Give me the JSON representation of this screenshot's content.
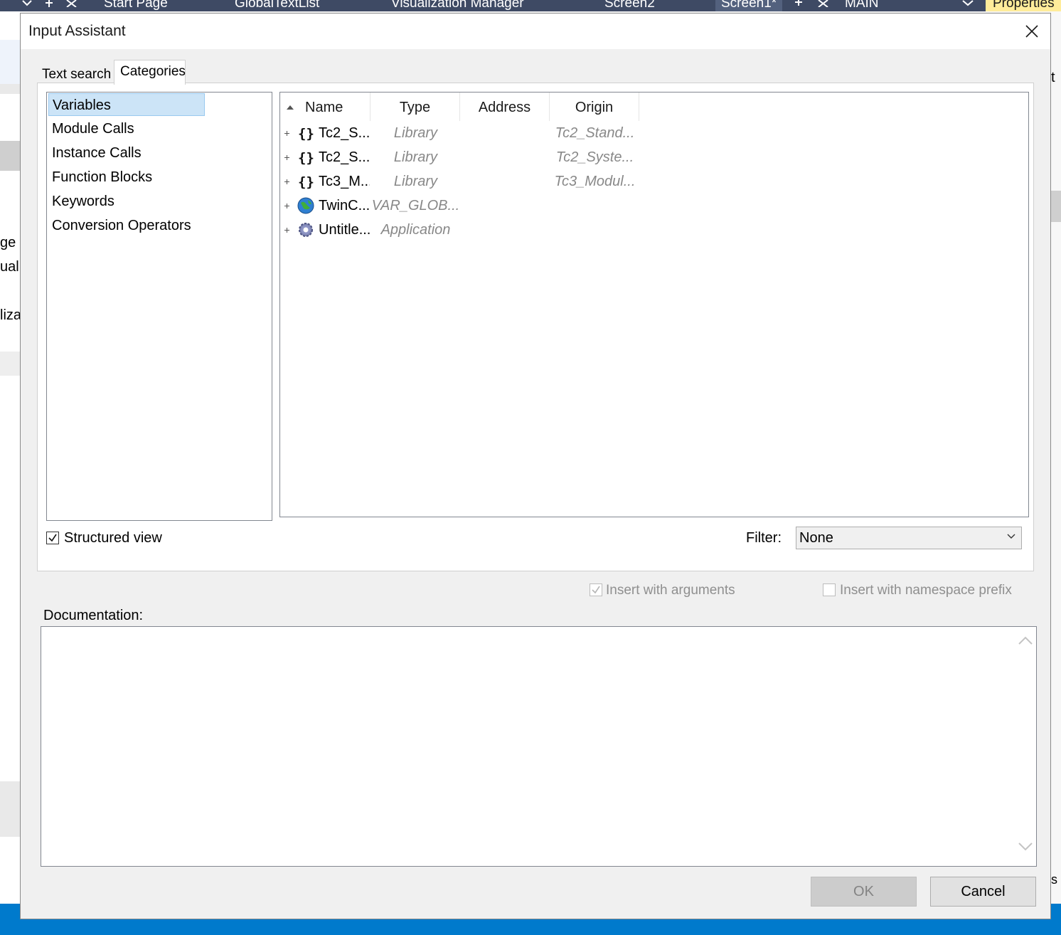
{
  "ide": {
    "tabs": [
      "Start Page",
      "GlobalTextList",
      "Visualization Manager",
      "Screen2",
      "Screen1*",
      "MAIN"
    ],
    "properties_label": "Properties",
    "left_fragments": [
      "ge",
      "uali",
      "liza"
    ],
    "right_fragments": [
      "t",
      "s"
    ]
  },
  "dialog": {
    "title": "Input Assistant",
    "tabs": {
      "text_search": "Text search",
      "categories": "Categories"
    },
    "categories": [
      "Variables",
      "Module Calls",
      "Instance Calls",
      "Function Blocks",
      "Keywords",
      "Conversion Operators"
    ],
    "selected_category": "Variables",
    "columns": {
      "name": "Name",
      "type": "Type",
      "address": "Address",
      "origin": "Origin"
    },
    "rows": [
      {
        "name": "Tc2_S...",
        "type": "Library",
        "address": "",
        "origin": "Tc2_Stand...",
        "icon": "namespace-icon"
      },
      {
        "name": "Tc2_S...",
        "type": "Library",
        "address": "",
        "origin": "Tc2_Syste...",
        "icon": "namespace-icon"
      },
      {
        "name": "Tc3_M...",
        "type": "Library",
        "address": "",
        "origin": "Tc3_Modul...",
        "icon": "namespace-icon"
      },
      {
        "name": "TwinC...",
        "type": "VAR_GLOB...",
        "address": "",
        "origin": "",
        "icon": "globe-icon"
      },
      {
        "name": "Untitle...",
        "type": "Application",
        "address": "",
        "origin": "",
        "icon": "gear-icon"
      }
    ],
    "structured_view": {
      "label": "Structured view",
      "checked": true
    },
    "filter": {
      "label": "Filter:",
      "value": "None"
    },
    "insert_with_arguments": {
      "label": "Insert with arguments",
      "checked": true,
      "enabled": false
    },
    "insert_with_namespace_prefix": {
      "label": "Insert with namespace prefix",
      "checked": false,
      "enabled": false
    },
    "documentation_label": "Documentation:",
    "documentation_text": "",
    "ok_label": "OK",
    "cancel_label": "Cancel"
  }
}
